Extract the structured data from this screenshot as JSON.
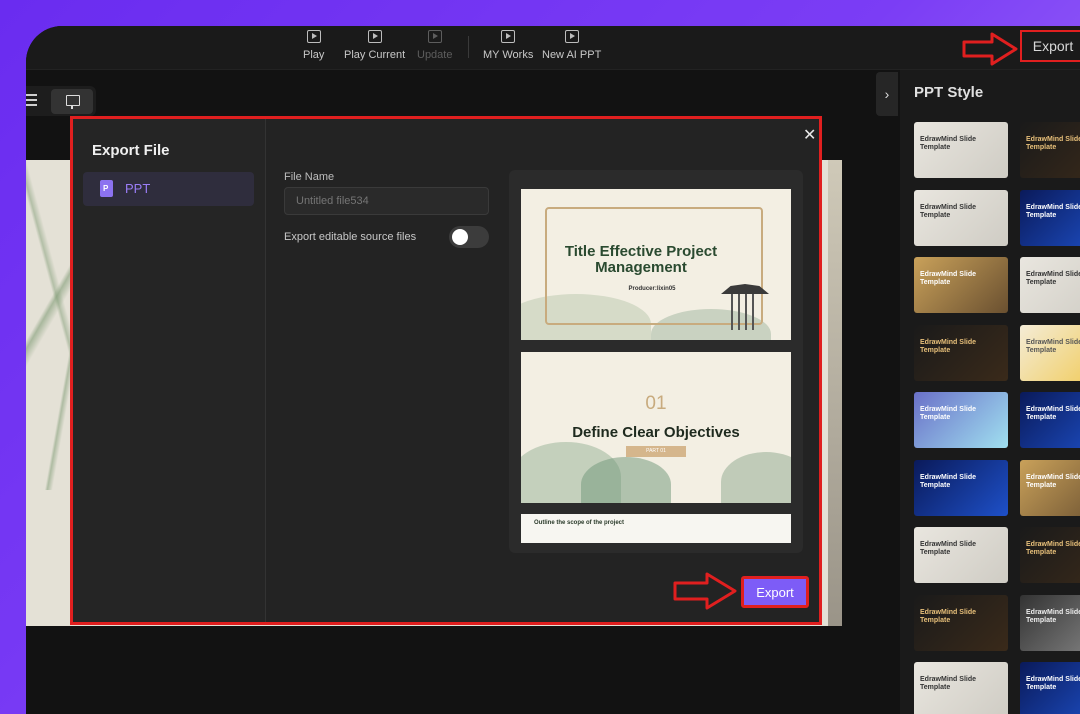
{
  "toolbar": {
    "items": [
      {
        "label": "Play",
        "icon": "play-icon",
        "enabled": true
      },
      {
        "label": "Play Current",
        "icon": "play-current-icon",
        "enabled": true
      },
      {
        "label": "Update",
        "icon": "update-icon",
        "enabled": false
      },
      {
        "label": "MY Works",
        "icon": "my-works-icon",
        "enabled": true
      },
      {
        "label": "New AI PPT",
        "icon": "new-ai-ppt-icon",
        "enabled": true
      }
    ],
    "export_label": "Export"
  },
  "right_panel": {
    "title": "PPT Style",
    "thumbnails": [
      {
        "text": "EdrawMind Slide Template",
        "theme": "light"
      },
      {
        "text": "EdrawMind Slide Template",
        "theme": "dark"
      },
      {
        "text": "EdrawMind Slide Template",
        "theme": "light"
      },
      {
        "text": "EdrawMind Slide Template",
        "theme": "blue"
      },
      {
        "text": "EdrawMind Slide Template",
        "theme": "gold"
      },
      {
        "text": "EdrawMind Slide Template",
        "theme": "light"
      },
      {
        "text": "EdrawMind Slide Template",
        "theme": "dark"
      },
      {
        "text": "EdrawMind Slide Template",
        "theme": "yellow"
      },
      {
        "text": "EdrawMind Slide Template",
        "theme": "purple"
      },
      {
        "text": "EdrawMind Slide Template",
        "theme": "blue"
      },
      {
        "text": "EdrawMind Slide Template",
        "theme": "blue"
      },
      {
        "text": "EdrawMind Slide Template",
        "theme": "gold"
      },
      {
        "text": "EdrawMind Slide Template",
        "theme": "light"
      },
      {
        "text": "EdrawMind Slide Template",
        "theme": "dark"
      },
      {
        "text": "EdrawMind Slide Template",
        "theme": "dark"
      },
      {
        "text": "EdrawMind Slide Template",
        "theme": "gray"
      },
      {
        "text": "EdrawMind Slide Template",
        "theme": "light"
      },
      {
        "text": "EdrawMind Slide Template",
        "theme": "blue"
      }
    ]
  },
  "modal": {
    "title": "Export File",
    "formats": [
      {
        "label": "PPT",
        "selected": true
      }
    ],
    "file_name_label": "File Name",
    "file_name_placeholder": "Untitled file534",
    "source_files_label": "Export editable source files",
    "source_files_enabled": false,
    "preview": {
      "slide1_title": "Title Effective Project Management",
      "slide1_producer": "Producer:lixin05",
      "slide2_number": "01",
      "slide2_title": "Define Clear Objectives",
      "slide2_part": "PART 01",
      "slide3_text": "Outline the scope of the project"
    },
    "export_label": "Export"
  },
  "colors": {
    "accent": "#7d5cf7",
    "highlight_red": "#e01f1f",
    "background": "#121212"
  }
}
